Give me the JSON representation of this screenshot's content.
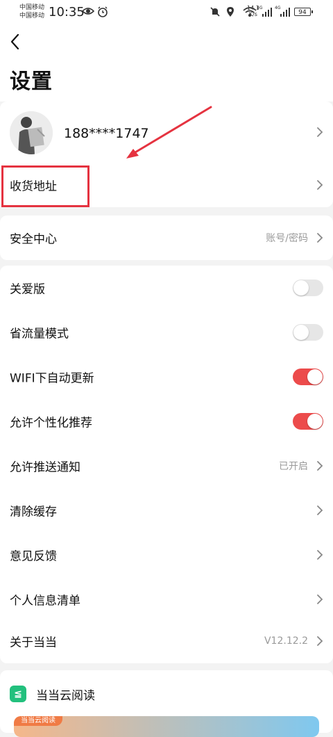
{
  "status_bar": {
    "carrier1": "中国移动",
    "carrier2": "中国移动",
    "time": "10:35",
    "speed_value": "14.1",
    "speed_unit": "K/s",
    "net1": "4G",
    "net2": "4G",
    "battery": "94"
  },
  "header": {
    "title": "设置"
  },
  "account": {
    "phone": "188****1747"
  },
  "address": {
    "label": "收货地址"
  },
  "security": {
    "label": "安全中心",
    "value": "账号/密码"
  },
  "settings": {
    "items": [
      {
        "label": "关爱版",
        "toggle_on": false
      },
      {
        "label": "省流量模式",
        "toggle_on": false
      },
      {
        "label": "WIFI下自动更新",
        "toggle_on": true
      },
      {
        "label": "允许个性化推荐",
        "toggle_on": true
      },
      {
        "label": "允许推送通知",
        "value": "已开启"
      },
      {
        "label": "清除缓存"
      },
      {
        "label": "意见反馈"
      },
      {
        "label": "个人信息清单"
      },
      {
        "label": "关于当当",
        "value": "V12.12.2"
      }
    ]
  },
  "cloud": {
    "label": "当当云阅读",
    "banner_tag": "当当云阅读"
  },
  "colors": {
    "accent": "#ec4b4b",
    "annotation": "#e53340",
    "cloud_green": "#22c07d"
  }
}
